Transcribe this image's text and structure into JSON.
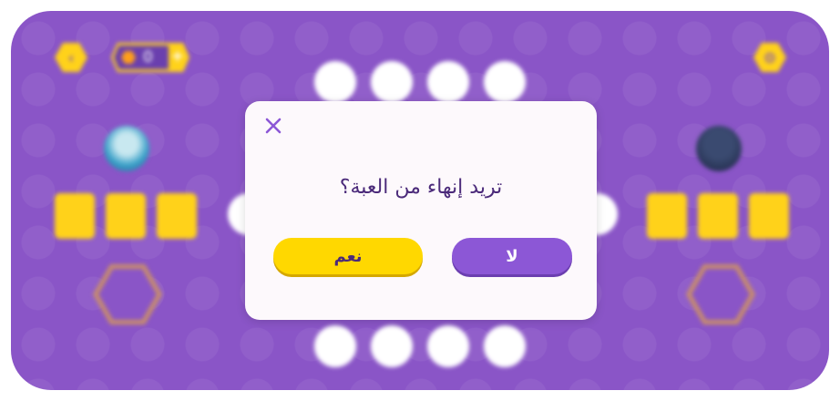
{
  "header": {
    "back_icon": "chevron-left-icon",
    "coins": "0",
    "add_icon": "plus-icon",
    "settings_icon": "gear-icon"
  },
  "dialog": {
    "question": "تريد إنهاء من العبة؟",
    "yes_label": "نعم",
    "no_label": "لا",
    "close_icon": "close-icon"
  },
  "colors": {
    "board": "#8a55c7",
    "accent_yellow": "#ffd21a",
    "button_purple": "#8c57d6",
    "text_dark": "#4b2a7a"
  }
}
